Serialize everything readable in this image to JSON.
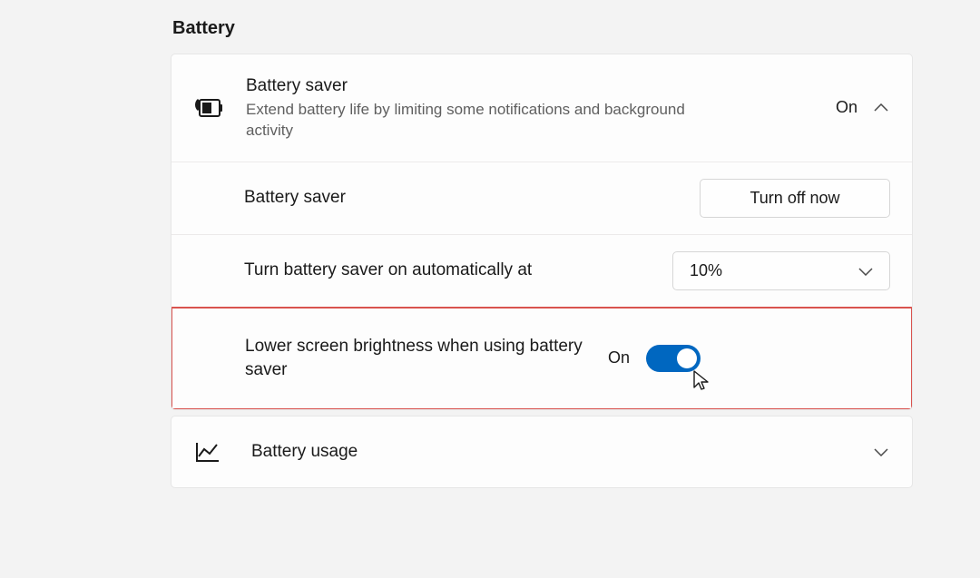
{
  "section_title": "Battery",
  "battery_saver": {
    "title": "Battery saver",
    "subtitle": "Extend battery life by limiting some notifications and background activity",
    "status": "On"
  },
  "battery_saver_toggle": {
    "label": "Battery saver",
    "button": "Turn off now"
  },
  "auto_on": {
    "label": "Turn battery saver on automatically at",
    "value": "10%"
  },
  "lower_brightness": {
    "label": "Lower screen brightness when using battery saver",
    "status": "On"
  },
  "battery_usage": {
    "label": "Battery usage"
  }
}
